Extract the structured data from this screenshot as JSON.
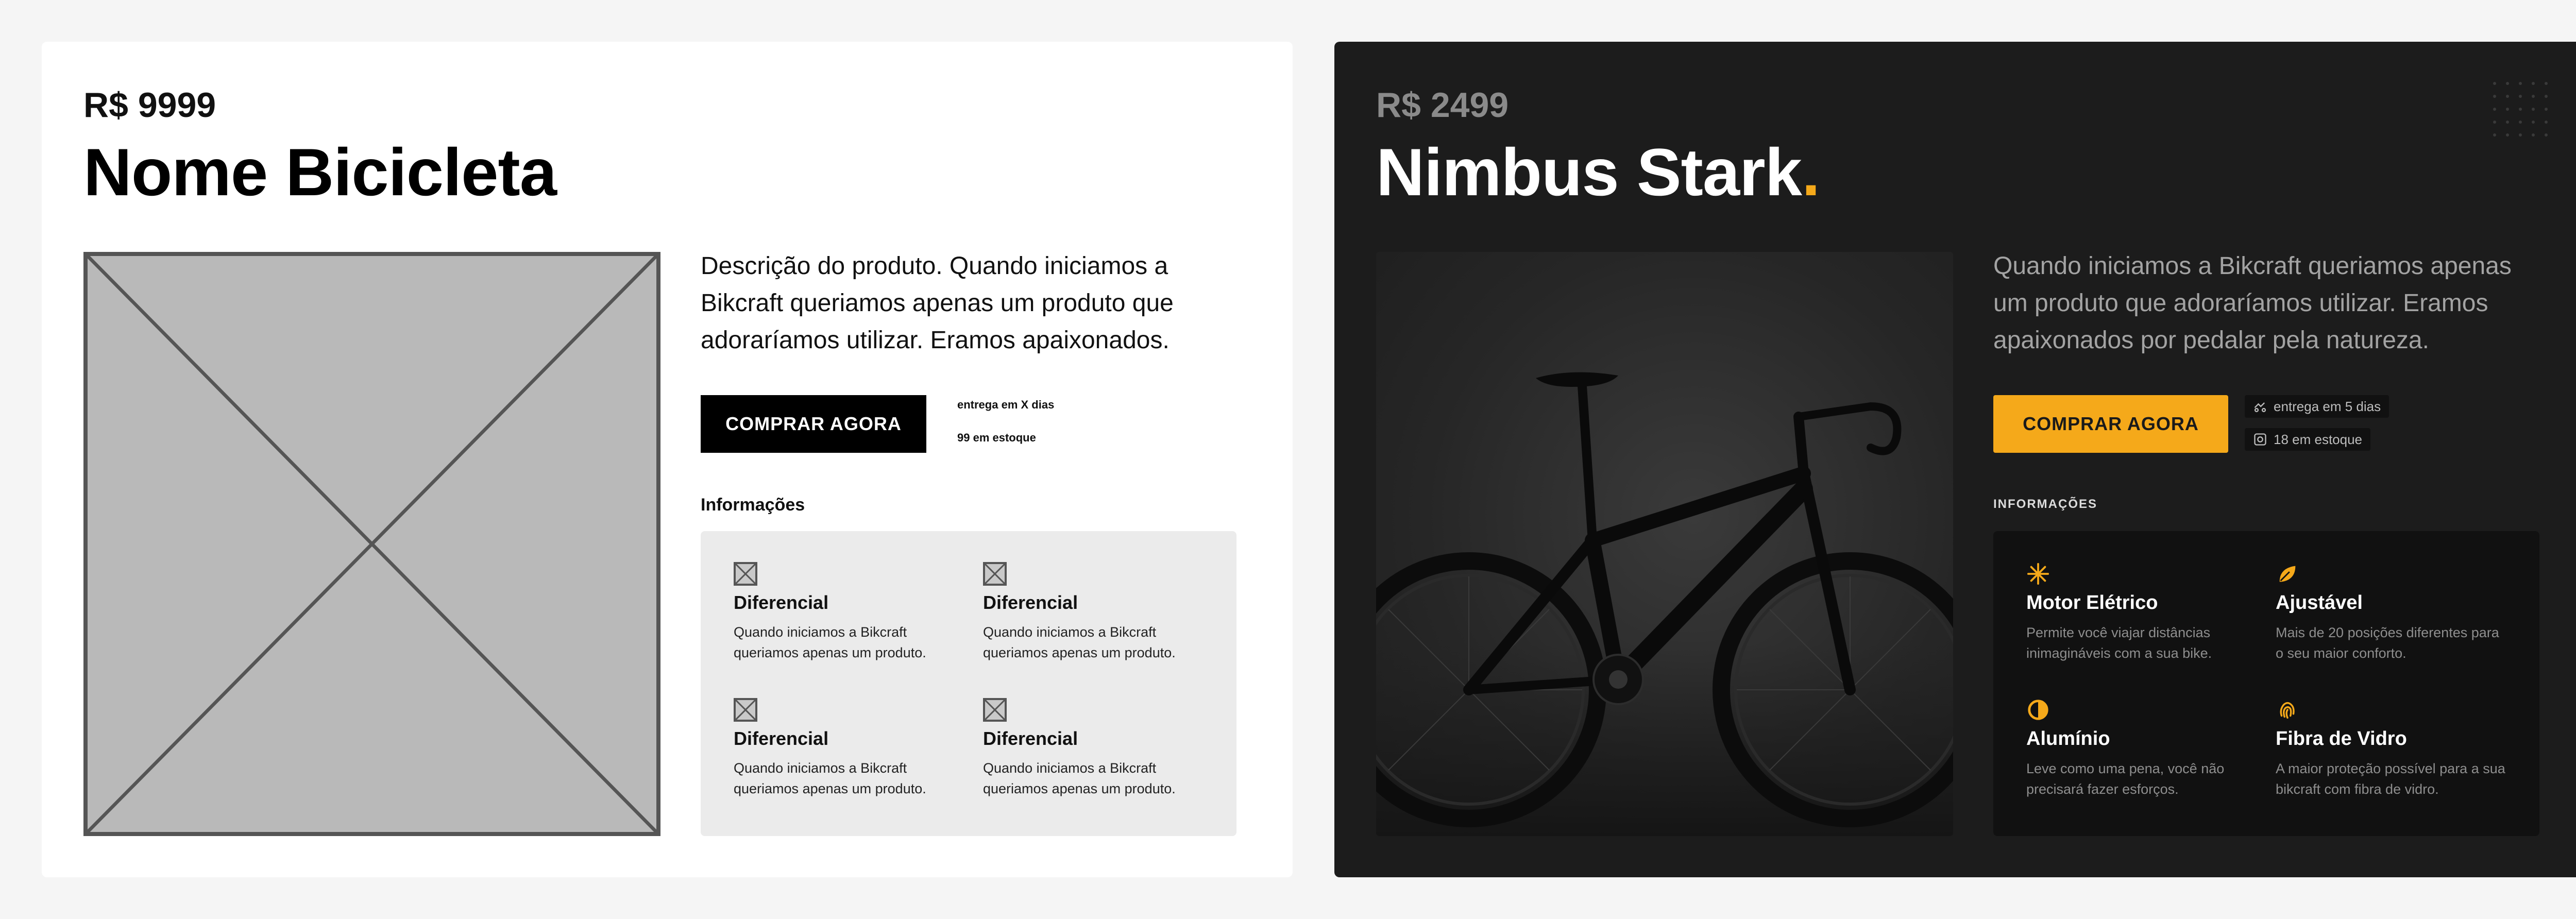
{
  "wireframe": {
    "price": "R$ 9999",
    "title": "Nome Bicicleta",
    "description": "Descrição do produto. Quando iniciamos a Bikcraft queriamos apenas um produto que adoraríamos utilizar. Eramos apaixonados.",
    "buy_button": "COMPRAR AGORA",
    "delivery": "entrega em X dias",
    "stock": "99 em estoque",
    "info_label": "Informações",
    "features": [
      {
        "title": "Diferencial",
        "text": "Quando iniciamos a Bikcraft queriamos apenas um produto."
      },
      {
        "title": "Diferencial",
        "text": "Quando iniciamos a Bikcraft queriamos apenas um produto."
      },
      {
        "title": "Diferencial",
        "text": "Quando iniciamos a Bikcraft queriamos apenas um produto."
      },
      {
        "title": "Diferencial",
        "text": "Quando iniciamos a Bikcraft queriamos apenas um produto."
      }
    ]
  },
  "product": {
    "price": "R$ 2499",
    "title": "Nimbus Stark",
    "title_dot": ".",
    "description": "Quando iniciamos a Bikcraft queriamos apenas um produto que adoraríamos utilizar. Eramos apaixonados por pedalar pela natureza.",
    "buy_button": "COMPRAR AGORA",
    "delivery": "entrega em 5 dias",
    "stock": "18 em estoque",
    "info_label": "INFORMAÇÕES",
    "features": [
      {
        "icon": "electric-icon",
        "title": "Motor Elétrico",
        "text": "Permite você viajar distâncias inimagináveis com a sua bike."
      },
      {
        "icon": "leaf-icon",
        "title": "Ajustável",
        "text": "Mais de 20 posições diferentes para o seu maior conforto."
      },
      {
        "icon": "contrast-icon",
        "title": "Alumínio",
        "text": "Leve como uma pena, você não precisará fazer esforços."
      },
      {
        "icon": "fingerprint-icon",
        "title": "Fibra de Vidro",
        "text": "A maior proteção possível para a sua bikcraft com fibra de vidro."
      }
    ]
  },
  "colors": {
    "accent": "#f5a91a",
    "dark_bg": "#1c1c1c",
    "panel_dark": "#111111",
    "light_bg": "#ffffff",
    "page_bg": "#f5f5f5"
  }
}
